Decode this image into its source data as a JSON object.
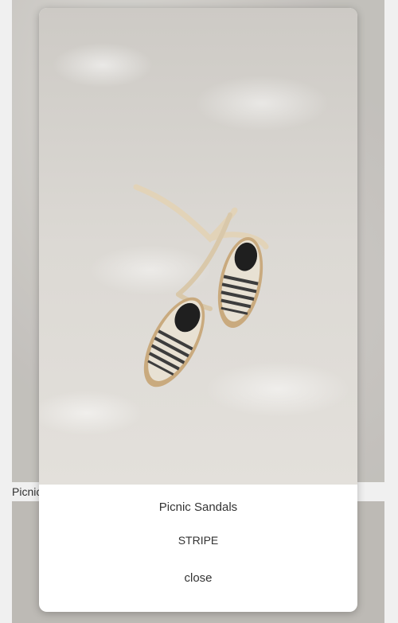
{
  "background": {
    "caption": "Picnic Sandals"
  },
  "modal": {
    "image_alt": "Striped espadrille sandals with ribbon ties on a sunlit surface",
    "product_title": "Picnic Sandals",
    "variant": "STRIPE",
    "close_label": "close"
  }
}
